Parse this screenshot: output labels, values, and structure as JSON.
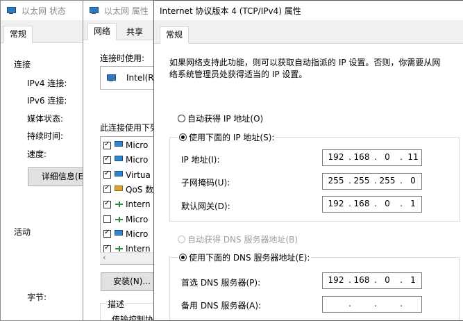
{
  "status_window": {
    "title": "以太网 状态",
    "tab": "常规",
    "connection_header": "连接",
    "rows": [
      "IPv4 连接:",
      "IPv6 连接:",
      "媒体状态:",
      "持续时间:",
      "速度:"
    ],
    "details_button": "详细信息(E",
    "activity_header": "活动",
    "bytes_label": "字节:"
  },
  "props_window": {
    "title": "以太网 属性",
    "tabs": [
      "网络",
      "共享"
    ],
    "connect_using_label": "连接时使用:",
    "adapter_name": "Intel(R",
    "items_label": "此连接使用下列",
    "items": [
      {
        "label": "Micro",
        "checked": true,
        "icon": "network-client-icon"
      },
      {
        "label": "Micro",
        "checked": true,
        "icon": "network-client-icon"
      },
      {
        "label": "Virtua",
        "checked": true,
        "icon": "network-client-icon"
      },
      {
        "label": "QoS 数",
        "checked": true,
        "icon": "qos-icon"
      },
      {
        "label": "Intern",
        "checked": true,
        "icon": "protocol-icon"
      },
      {
        "label": "Micro",
        "checked": false,
        "icon": "protocol-icon"
      },
      {
        "label": "Micro",
        "checked": true,
        "icon": "network-client-icon"
      },
      {
        "label": "Intern",
        "checked": true,
        "icon": "protocol-icon"
      }
    ],
    "install_button": "安装(N)...",
    "description_label": "描述",
    "description_text": "传输控制协"
  },
  "ipv4_dialog": {
    "title": "Internet 协议版本 4 (TCP/IPv4) 属性",
    "tab": "常规",
    "intro_line1": "如果网络支持此功能，则可以获取自动指派的 IP 设置。否则，你需要从网",
    "intro_line2": "络系统管理员处获得适当的 IP 设置。",
    "auto_ip_label": "自动获得 IP 地址(O)",
    "manual_ip_label": "使用下面的 IP 地址(S):",
    "ip_label": "IP 地址(I):",
    "subnet_label": "子网掩码(U):",
    "gateway_label": "默认网关(D):",
    "ip": [
      "192",
      "168",
      "0",
      "11"
    ],
    "subnet": [
      "255",
      "255",
      "255",
      "0"
    ],
    "gateway": [
      "192",
      "168",
      "0",
      "1"
    ],
    "auto_dns_label": "自动获得 DNS 服务器地址(B)",
    "manual_dns_label": "使用下面的 DNS 服务器地址(E):",
    "pref_dns_label": "首选 DNS 服务器(P):",
    "alt_dns_label": "备用 DNS 服务器(A):",
    "pref_dns": [
      "192",
      "168",
      "0",
      "1"
    ],
    "alt_dns": [
      "",
      "",
      "",
      ""
    ]
  },
  "colors": {
    "window_bg": "#f0f0f0",
    "page_bg": "#ffffff",
    "border": "#adadad"
  }
}
